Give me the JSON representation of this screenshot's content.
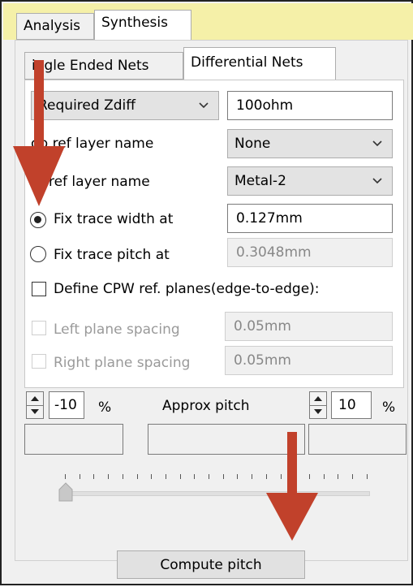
{
  "top_tabs": [
    "Analysis",
    "Synthesis"
  ],
  "sub_tabs": [
    "ingle Ended Nets",
    "Differential Nets"
  ],
  "synthesis": {
    "target_select": "Required Zdiff",
    "target_value": "100ohm",
    "top_ref_label": "op ref layer name",
    "top_ref_value": "None",
    "bot_ref_label": "m ref layer name",
    "bot_ref_value": "Metal-2",
    "fix_width_label": "Fix trace width at",
    "fix_width_value": "0.127mm",
    "fix_pitch_label": "Fix trace pitch at",
    "fix_pitch_value": "0.3048mm",
    "cpw_label": "Define CPW ref. planes(edge-to-edge):",
    "left_plane_label": "Left plane spacing",
    "left_plane_value": "0.05mm",
    "right_plane_label": "Right plane spacing",
    "right_plane_value": "0.05mm"
  },
  "pitch": {
    "lower_value": "-10",
    "upper_value": "10",
    "percent": "%",
    "approx_label": "Approx pitch",
    "slider_position": 0
  },
  "compute_button": "Compute pitch",
  "colors": {
    "arrow": "#c1412b",
    "title_bar": "#f5f0a8"
  }
}
